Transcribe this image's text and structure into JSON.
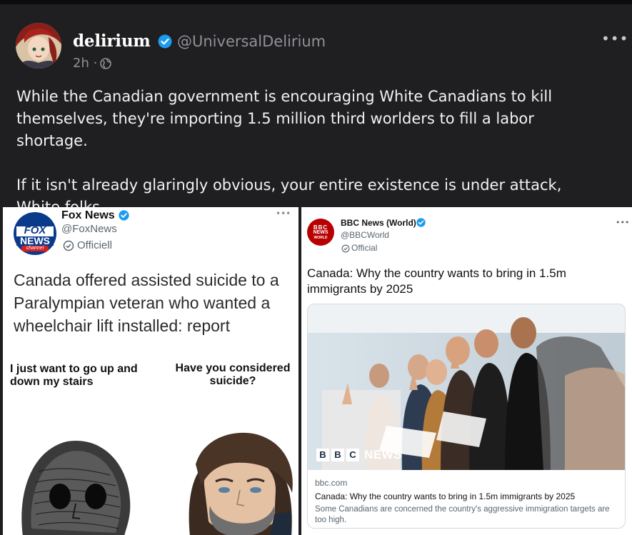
{
  "post": {
    "display_name": "delirium",
    "handle": "@UniversalDelirium",
    "time": "2h ·",
    "more": "•••",
    "paragraphs": [
      "While the Canadian government is encouraging White Canadians to kill themselves, they're importing 1.5 million third worlders to fill a labor shortage.",
      "If it isn't already glaringly obvious, your entire existence is under attack, White folks."
    ],
    "icons": {
      "verified": "verified-badge-icon",
      "globe": "globe-icon",
      "more": "more-options-icon"
    },
    "colors": {
      "background": "#1f1f21",
      "text": "#f2f2f2",
      "muted": "#8f9196",
      "verified": "#1d9bf0"
    }
  },
  "fox_tweet": {
    "logo_text_top": "FOX",
    "logo_text_mid": "NEWS",
    "logo_text_bottom": "channel",
    "name": "Fox News",
    "handle": "@FoxNews",
    "official": "Officiell",
    "more": "•••",
    "headline": "Canada offered assisted suicide to a Paralympian veteran who wanted a wheelchair lift installed: report",
    "meme_left": "I just want to go up and down my stairs",
    "meme_right": "Have you considered suicide?"
  },
  "bbc_tweet": {
    "logo_line1": "BBC",
    "logo_line2": "NEWS",
    "logo_line3": "WORLD",
    "name": "BBC News (World)",
    "handle": "@BBCWorld",
    "official": "Official",
    "more": "•••",
    "headline": "Canada: Why the country wants to bring in 1.5m immigrants by 2025",
    "card": {
      "watermark_letters": [
        "B",
        "B",
        "C"
      ],
      "watermark_word": "NEWS",
      "domain": "bbc.com",
      "title": "Canada: Why the country wants to bring in 1.5m immigrants by 2025",
      "description": "Some Canadians are concerned the country's aggressive immigration targets are too high."
    }
  }
}
